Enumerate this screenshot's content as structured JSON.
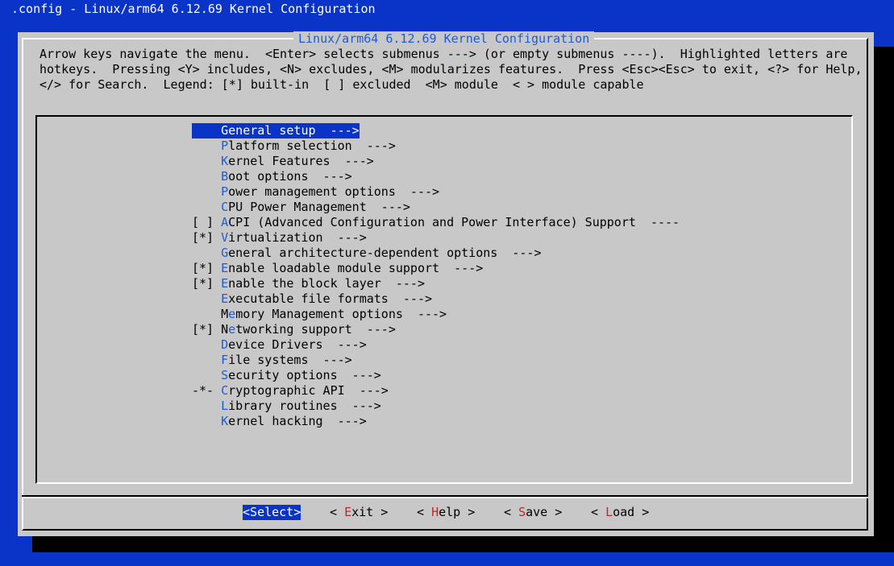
{
  "window_title": ".config - Linux/arm64 6.12.69 Kernel Configuration",
  "dialog": {
    "title": "Linux/arm64 6.12.69 Kernel Configuration",
    "help_lines": [
      "Arrow keys navigate the menu.  <Enter> selects submenus ---> (or empty submenus ----).  Highlighted letters are",
      "hotkeys.  Pressing <Y> includes, <N> excludes, <M> modularizes features.  Press <Esc><Esc> to exit, <?> for Help,",
      "</> for Search.  Legend: [*] built-in  [ ] excluded  <M> module  < > module capable"
    ]
  },
  "menu": {
    "selected_index": 0,
    "items": [
      {
        "prefix": "    ",
        "hotkey": "G",
        "rest": "eneral setup  --->"
      },
      {
        "prefix": "    ",
        "hotkey": "P",
        "rest": "latform selection  --->"
      },
      {
        "prefix": "    ",
        "hotkey": "K",
        "rest": "ernel Features  --->"
      },
      {
        "prefix": "    ",
        "hotkey": "B",
        "rest": "oot options  --->"
      },
      {
        "prefix": "    ",
        "hotkey": "P",
        "rest": "ower management options  --->"
      },
      {
        "prefix": "    ",
        "hotkey": "C",
        "rest": "PU Power Management  --->"
      },
      {
        "prefix": "[ ] ",
        "hotkey": "A",
        "rest": "CPI (Advanced Configuration and Power Interface) Support  ----"
      },
      {
        "prefix": "[*] ",
        "hotkey": "V",
        "rest": "irtualization  --->"
      },
      {
        "prefix": "    ",
        "hotkey": "G",
        "rest": "eneral architecture-dependent options  --->"
      },
      {
        "prefix": "[*] ",
        "hotkey": "E",
        "rest": "nable loadable module support  --->"
      },
      {
        "prefix": "[*] ",
        "hotkey": "E",
        "rest": "nable the block layer  --->"
      },
      {
        "prefix": "    ",
        "hotkey": "E",
        "rest": "xecutable file formats  --->"
      },
      {
        "prefix": "    M",
        "hotkey": "e",
        "rest": "mory Management options  --->"
      },
      {
        "prefix": "[*] N",
        "hotkey": "e",
        "rest": "tworking support  --->"
      },
      {
        "prefix": "    ",
        "hotkey": "D",
        "rest": "evice Drivers  --->"
      },
      {
        "prefix": "    ",
        "hotkey": "F",
        "rest": "ile systems  --->"
      },
      {
        "prefix": "    ",
        "hotkey": "S",
        "rest": "ecurity options  --->"
      },
      {
        "prefix": "-*- ",
        "hotkey": "C",
        "rest": "ryptographic API  --->"
      },
      {
        "prefix": "    ",
        "hotkey": "L",
        "rest": "ibrary routines  --->"
      },
      {
        "prefix": "    ",
        "hotkey": "K",
        "rest": "ernel hacking  --->"
      }
    ]
  },
  "buttons": [
    {
      "before": "<",
      "hotkey": "S",
      "after": "elect>",
      "selected": true
    },
    {
      "before": "< ",
      "hotkey": "E",
      "after": "xit >",
      "selected": false
    },
    {
      "before": "< ",
      "hotkey": "H",
      "after": "elp >",
      "selected": false
    },
    {
      "before": "< ",
      "hotkey": "S",
      "after": "ave >",
      "selected": false
    },
    {
      "before": "< ",
      "hotkey": "L",
      "after": "oad >",
      "selected": false
    }
  ],
  "colors": {
    "background": "#0a33c8",
    "dialog": "#c8c8c8",
    "hotkey": "#1f5bd6",
    "button_hotkey": "#c0272d"
  }
}
